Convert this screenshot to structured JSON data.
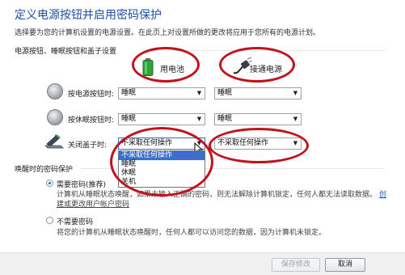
{
  "header": {
    "title": "定义电源按钮并启用密码保护",
    "subtitle": "选择要为您的计算机设置的电源设置。在此页上对设置所做的更改将应用于您所有的电源计划。"
  },
  "buttons_section": {
    "heading": "电源按钮、睡眠按钮和盖子设置",
    "col_battery": "用电池",
    "col_plugged": "接通电源",
    "rows": [
      {
        "label": "按电源按钮时:",
        "battery": "睡眠",
        "plugged": "睡眠"
      },
      {
        "label": "按休眠按钮时:",
        "battery": "睡眠",
        "plugged": "睡眠"
      },
      {
        "label": "关闭盖子时:",
        "battery": "不采取任何操作",
        "plugged": "不采取任何操作"
      }
    ]
  },
  "dropdown_open": {
    "options": [
      "不采取任何操作",
      "睡眠",
      "休眠",
      "关机"
    ],
    "selected_index": 0
  },
  "password_section": {
    "heading": "唤醒时的密码保护",
    "opt_require": {
      "label": "需要密码(推荐)",
      "desc_line1_a": "计算机从睡眠状态唤醒",
      "desc_line1_b": "，如果未输入正确的密码，则无法解除计算机锁定，任何人都无法读取数据。",
      "desc_link_tail": "创",
      "desc_line2_link": "建或更改用户帐户密码",
      "selected": true
    },
    "opt_no_password": {
      "label": "不需要密码",
      "desc": "将您的计算机从睡眠状态唤醒时，任何人都可以访问您的数据，因为计算机未锁定。",
      "selected": false
    }
  },
  "footer": {
    "save_label": "保存修改",
    "cancel_label": "取消"
  },
  "colors": {
    "title": "#1e4fa3",
    "highlight": "#3a6fd0",
    "annotation": "#c0141a",
    "link": "#1a5bc4"
  }
}
